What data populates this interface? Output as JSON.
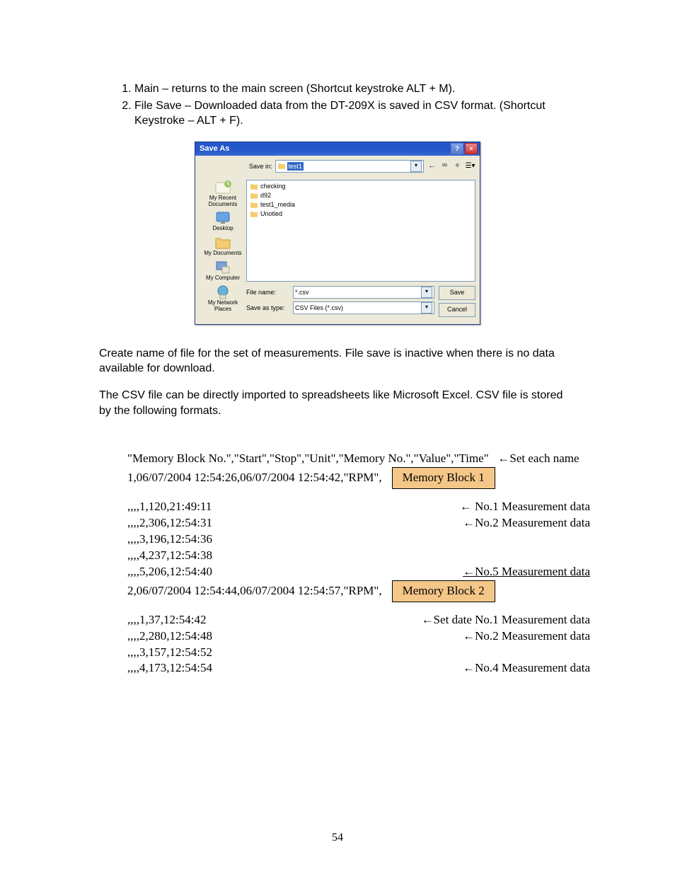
{
  "list": {
    "item1": "Main – returns to the main screen (Shortcut keystroke ALT + M).",
    "item2": "File Save – Downloaded data from the DT-209X is saved in CSV format. (Shortcut Keystroke – ALT + F)."
  },
  "dialog": {
    "title": "Save As",
    "help": "?",
    "close": "×",
    "save_in_label": "Save in:",
    "current_folder": "test1",
    "places": {
      "recent": "My Recent\nDocuments",
      "desktop": "Desktop",
      "mydocs": "My Documents",
      "mycomp": "My Computer",
      "network": "My Network\nPlaces"
    },
    "folders": [
      "checking",
      "d92",
      "test1_media",
      "Unotled"
    ],
    "file_name_label": "File name:",
    "file_name_value": "*.csv",
    "save_as_type_label": "Save as type:",
    "save_as_type_value": "CSV Files (*.csv)",
    "save_btn": "Save",
    "cancel_btn": "Cancel"
  },
  "para": {
    "create": "Create name of file for the set of measurements.  File save is inactive when there is no data available for download.",
    "csv": "The CSV file can be directly imported to spreadsheets like Microsoft Excel. CSV file is stored by the following formats."
  },
  "csv": {
    "header": "\"Memory Block No.\",\"Start\",\"Stop\",\"Unit\",\"Memory No.\",\"Value\",\"Time\"",
    "header_ann": "←Set each name",
    "b1_head": "1,06/07/2004 12:54:26,06/07/2004 12:54:42,\"RPM\",",
    "b1_box": "Memory Block 1",
    "l1": ",,,,1,120,21:49:11",
    "l1_ann": "← No.1 Measurement data",
    "l2": ",,,,2,306,12:54:31",
    "l2_ann": "←No.2 Measurement data",
    "l3": ",,,,3,196,12:54:36",
    "l4": ",,,,4,237,12:54:38",
    "l5": ",,,,5,206,12:54:40",
    "l5_ann": "←No.5 Measurement data",
    "b2_head": "2,06/07/2004 12:54:44,06/07/2004 12:54:57,\"RPM\",",
    "b2_box": "Memory Block 2",
    "m1": ",,,,1,37,12:54:42",
    "m1_ann": "←Set date No.1 Measurement data",
    "m2": ",,,,2,280,12:54:48",
    "m2_ann": "←No.2 Measurement data",
    "m3": ",,,,3,157,12:54:52",
    "m4": ",,,,4,173,12:54:54",
    "m4_ann": "←No.4 Measurement data"
  },
  "page_num": "54"
}
